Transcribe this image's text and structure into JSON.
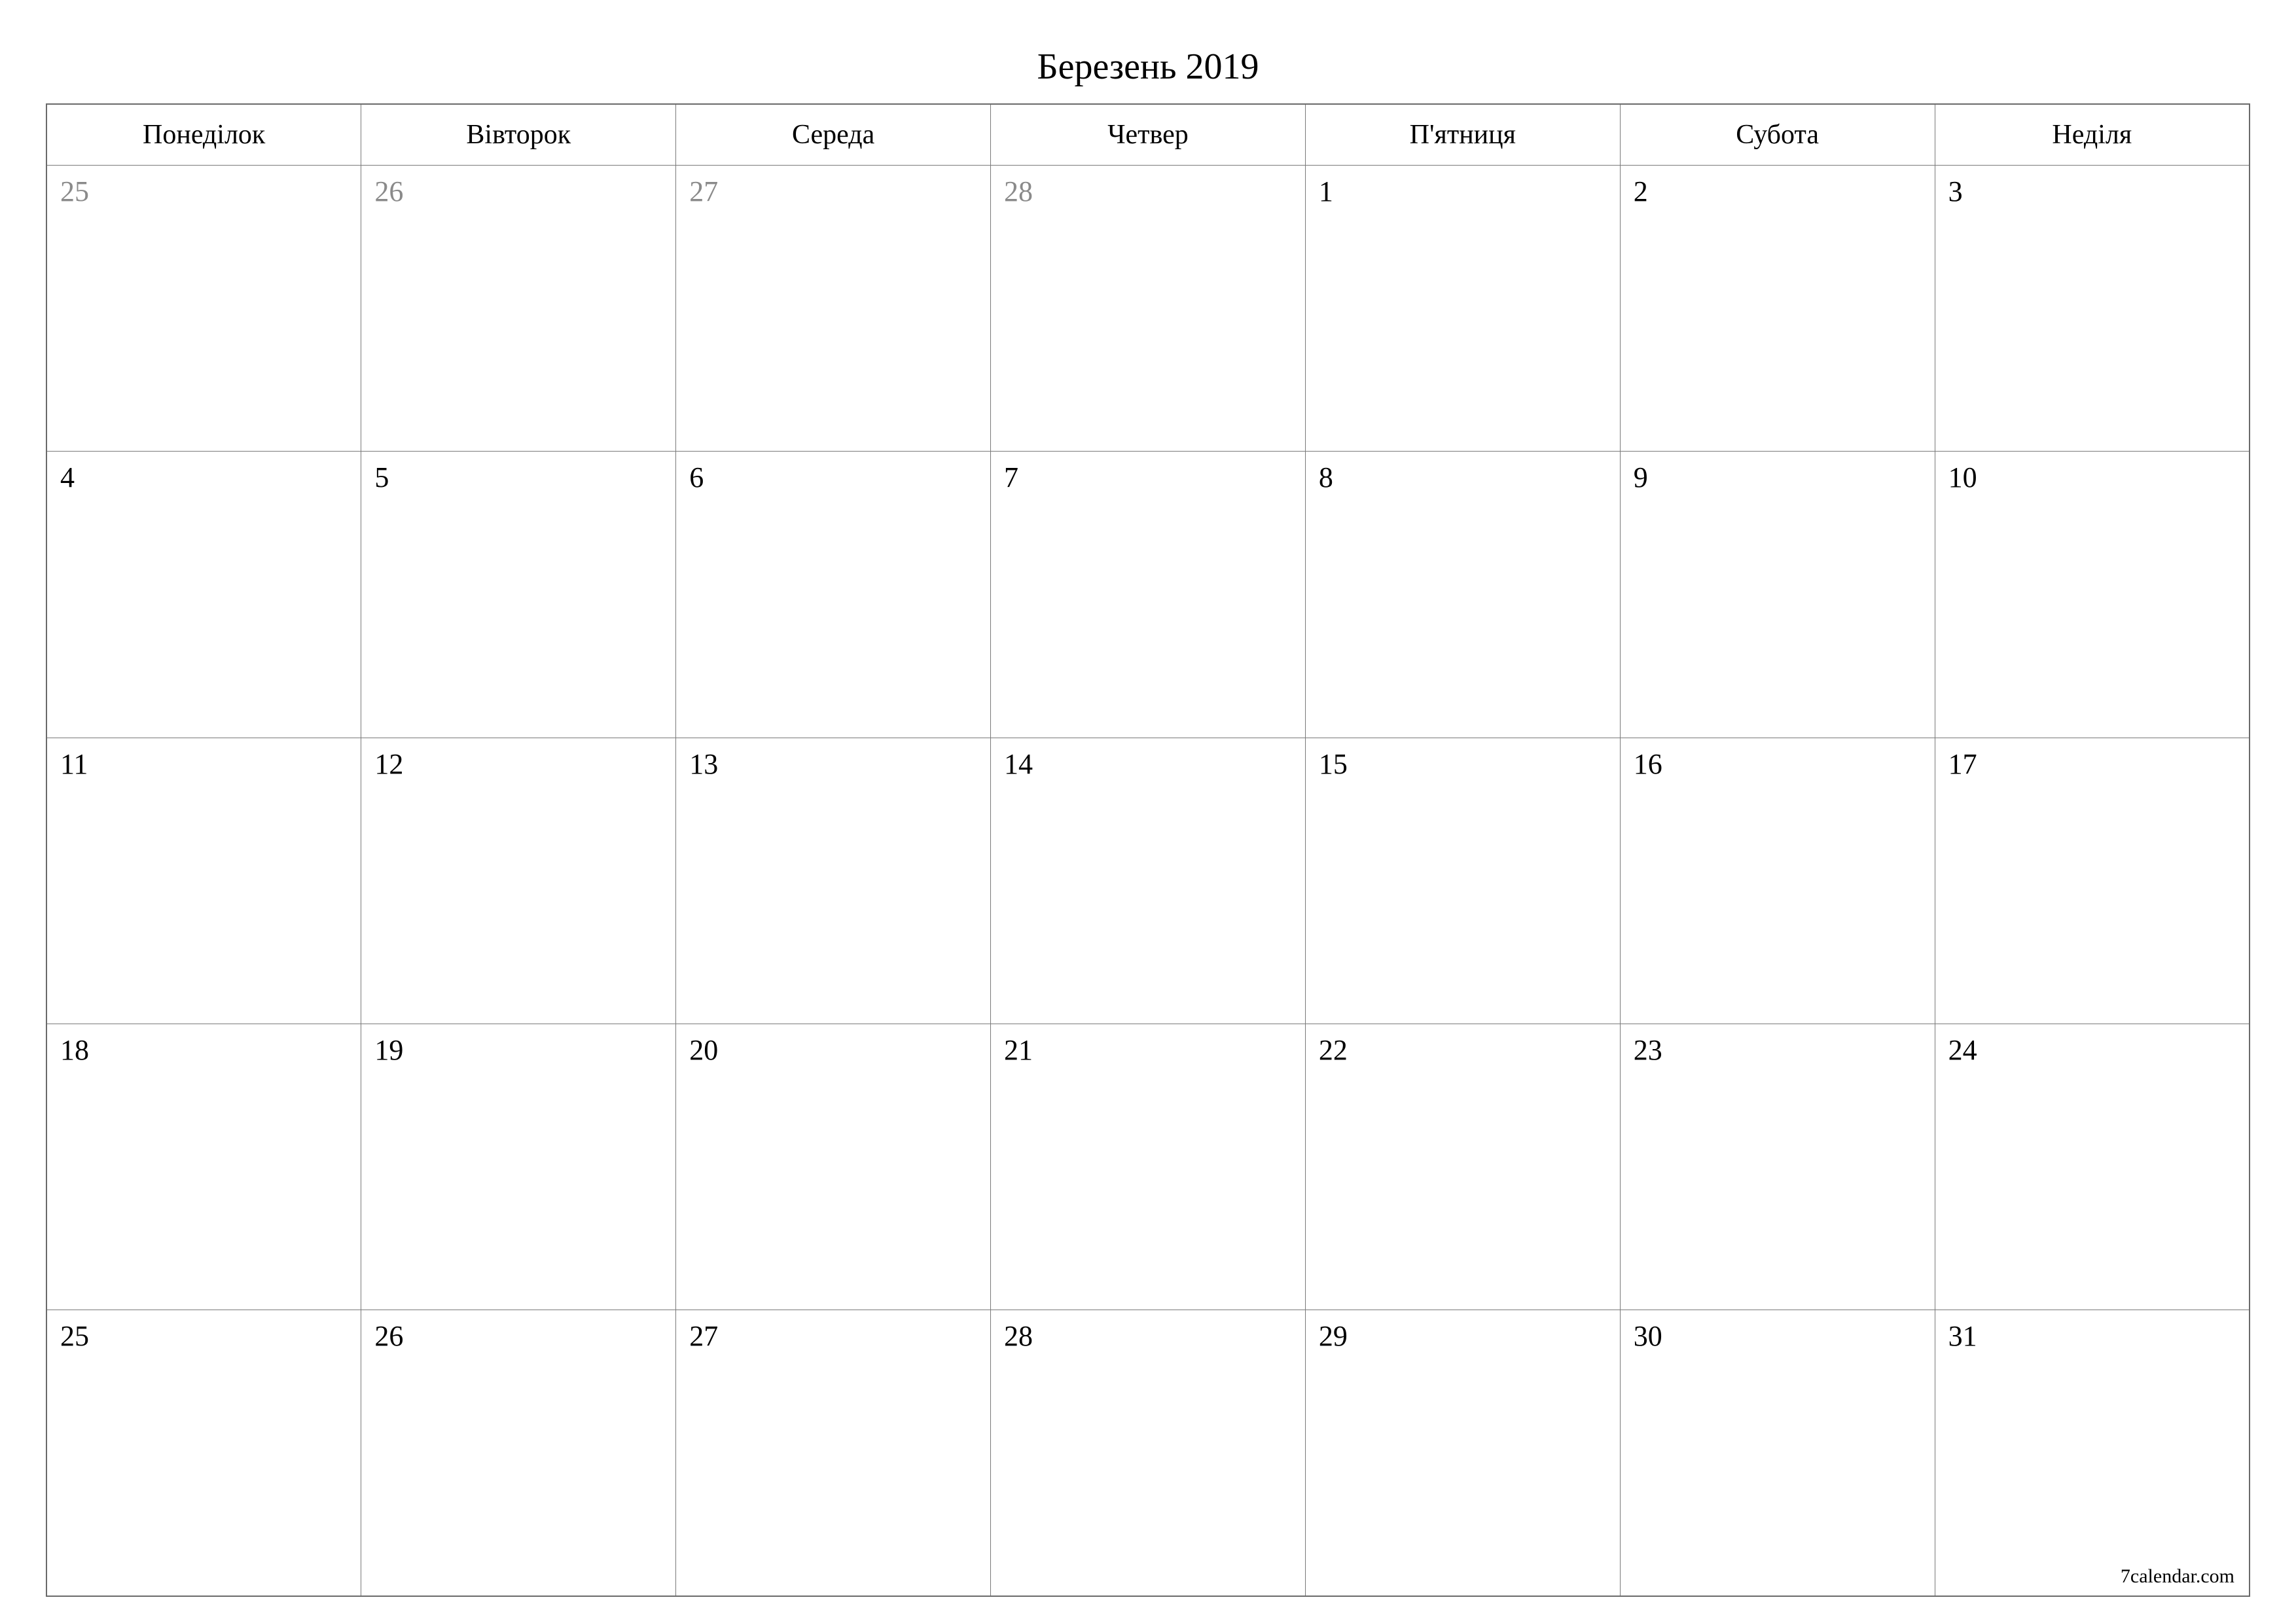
{
  "title": "Березень 2019",
  "weekdays": [
    "Понеділок",
    "Вівторок",
    "Середа",
    "Четвер",
    "П'ятниця",
    "Субота",
    "Неділя"
  ],
  "weeks": [
    [
      {
        "n": "25",
        "other": true
      },
      {
        "n": "26",
        "other": true
      },
      {
        "n": "27",
        "other": true
      },
      {
        "n": "28",
        "other": true
      },
      {
        "n": "1",
        "other": false
      },
      {
        "n": "2",
        "other": false
      },
      {
        "n": "3",
        "other": false
      }
    ],
    [
      {
        "n": "4",
        "other": false
      },
      {
        "n": "5",
        "other": false
      },
      {
        "n": "6",
        "other": false
      },
      {
        "n": "7",
        "other": false
      },
      {
        "n": "8",
        "other": false
      },
      {
        "n": "9",
        "other": false
      },
      {
        "n": "10",
        "other": false
      }
    ],
    [
      {
        "n": "11",
        "other": false
      },
      {
        "n": "12",
        "other": false
      },
      {
        "n": "13",
        "other": false
      },
      {
        "n": "14",
        "other": false
      },
      {
        "n": "15",
        "other": false
      },
      {
        "n": "16",
        "other": false
      },
      {
        "n": "17",
        "other": false
      }
    ],
    [
      {
        "n": "18",
        "other": false
      },
      {
        "n": "19",
        "other": false
      },
      {
        "n": "20",
        "other": false
      },
      {
        "n": "21",
        "other": false
      },
      {
        "n": "22",
        "other": false
      },
      {
        "n": "23",
        "other": false
      },
      {
        "n": "24",
        "other": false
      }
    ],
    [
      {
        "n": "25",
        "other": false
      },
      {
        "n": "26",
        "other": false
      },
      {
        "n": "27",
        "other": false
      },
      {
        "n": "28",
        "other": false
      },
      {
        "n": "29",
        "other": false
      },
      {
        "n": "30",
        "other": false
      },
      {
        "n": "31",
        "other": false
      }
    ]
  ],
  "footer": "7calendar.com"
}
